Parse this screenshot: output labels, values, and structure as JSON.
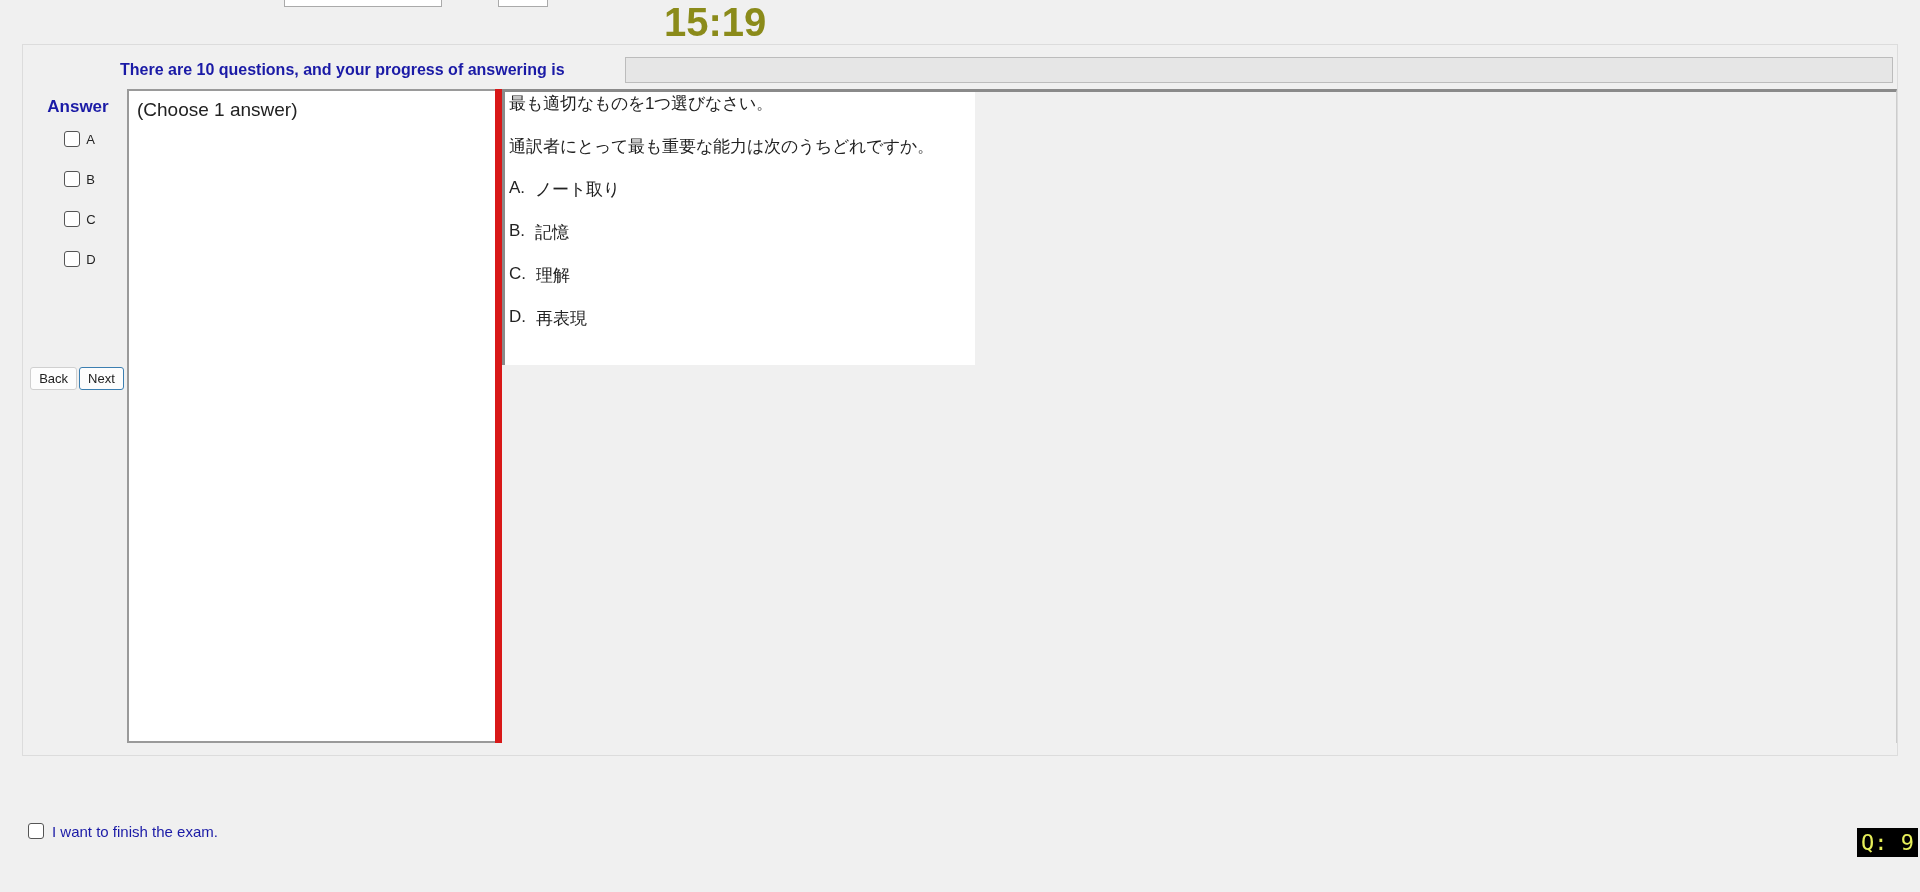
{
  "timer": "15:19",
  "progress": {
    "label": "There are 10 questions, and your progress of answering is",
    "level": 0
  },
  "answer": {
    "title": "Answer",
    "options": [
      {
        "label": "A",
        "checked": false
      },
      {
        "label": "B",
        "checked": false
      },
      {
        "label": "C",
        "checked": false
      },
      {
        "label": "D",
        "checked": false
      }
    ]
  },
  "buttons": [
    "Back",
    "Next"
  ],
  "answer_box": {
    "text": "(Choose 1 answer)"
  },
  "question": {
    "instruction": "最も適切なものを1つ選びなさい。",
    "text": "通訳者にとって最も重要な能力は次のうちどれですか。",
    "choices": [
      {
        "letter": "A.",
        "text": "ノート取り"
      },
      {
        "letter": "B.",
        "text": "記憶"
      },
      {
        "letter": "C.",
        "text": "理解"
      },
      {
        "letter": "D.",
        "text": "再表現"
      }
    ]
  },
  "finish": {
    "label": "I want to finish the exam.",
    "checked": false
  },
  "question_badge": "Q: 9"
}
